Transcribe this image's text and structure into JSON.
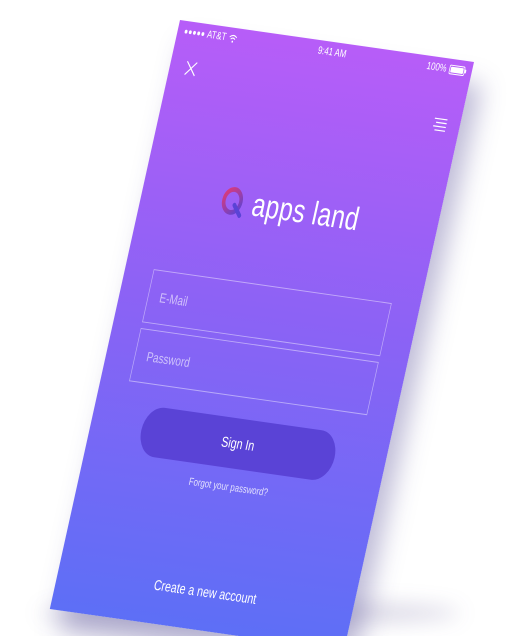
{
  "status_bar": {
    "carrier": "AT&T",
    "time": "9:41 AM",
    "battery": "100%"
  },
  "header": {
    "close_icon": "close-icon",
    "menu_icon": "menu-icon"
  },
  "logo": {
    "text": "apps land",
    "icon": "q-logo-icon",
    "icon_colors": [
      "#e23a74",
      "#5a43d6"
    ]
  },
  "form": {
    "email_placeholder": "E-Mail",
    "email_value": "",
    "password_placeholder": "Password",
    "password_value": "",
    "sign_in_label": "Sign In",
    "forgot_password": "Forgot your password?"
  },
  "footer": {
    "create_account": "Create a new account"
  },
  "colors": {
    "gradient_top": "#b75df8",
    "gradient_mid": "#8d62f5",
    "gradient_bottom": "#5d6ff6",
    "button": "#5a43d6",
    "background": "#ffffff"
  }
}
